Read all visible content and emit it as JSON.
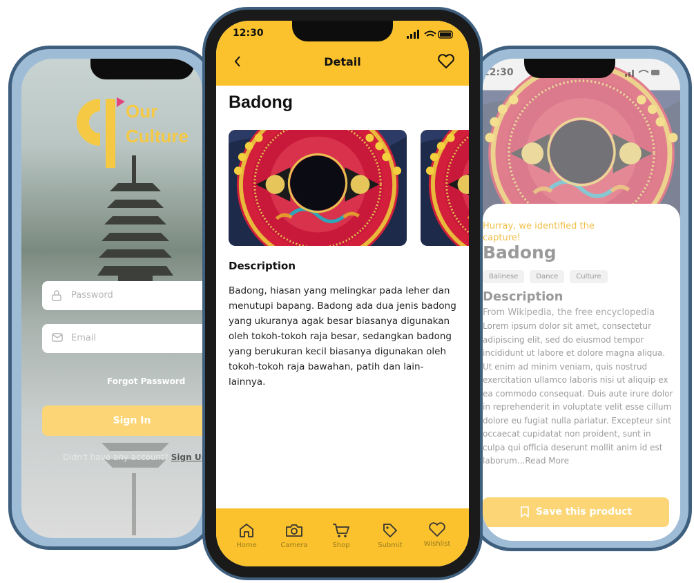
{
  "left_phone": {
    "logo_text_line1": "Our",
    "logo_text_line2": "Culture",
    "password_placeholder": "Password",
    "email_placeholder": "Email",
    "forgot_password": "Forgot Password",
    "sign_in": "Sign In",
    "no_account": "Didn't have any account?",
    "sign_up": "Sign Up here"
  },
  "center_phone": {
    "time": "12:30",
    "title": "Detail",
    "item_name": "Badong",
    "description_heading": "Description",
    "description": "Badong, hiasan yang melingkar pada leher dan menutupi bapang. Badong ada dua jenis badong yang ukuranya agak besar biasanya digunakan oleh tokoh-tokoh raja besar, sedangkan badong yang berukuran kecil biasanya digunakan oleh tokoh-tokoh raja bawahan, patih dan lain-lainnya.",
    "nav": [
      {
        "label": "Home",
        "icon": "home-icon"
      },
      {
        "label": "Camera",
        "icon": "camera-icon"
      },
      {
        "label": "Shop",
        "icon": "cart-icon"
      },
      {
        "label": "Submit",
        "icon": "tag-icon"
      },
      {
        "label": "Wishlist",
        "icon": "heart-icon"
      }
    ]
  },
  "right_phone": {
    "time": "12:30",
    "hurray": "Hurray, we identified the capture!",
    "title": "Badong",
    "tags": [
      "Balinese",
      "Dance",
      "Culture"
    ],
    "description_heading": "Description",
    "source": "From Wikipedia, the free encyclopedia",
    "lorem": "Lorem ipsum dolor sit amet, consectetur adipiscing elit, sed do eiusmod tempor incididunt ut labore et dolore magna aliqua. Ut enim ad minim veniam, quis nostrud exercitation ullamco laboris nisi ut aliquip ex ea commodo consequat. Duis aute irure dolor in reprehenderit in voluptate velit esse cillum dolore eu fugiat nulla pariatur. Excepteur sint occaecat cupidatat non proident, sunt in culpa qui officia deserunt mollit anim id est laborum...Read More",
    "save_button": "Save this product"
  },
  "colors": {
    "accent": "#fbc22d",
    "accent_light": "#fcd676",
    "frame": "#3f5f7e"
  }
}
